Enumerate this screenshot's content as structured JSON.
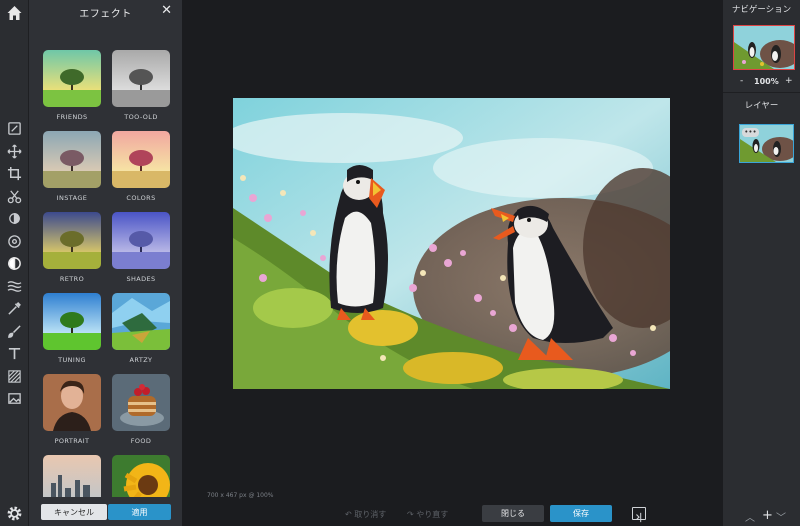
{
  "effects_panel": {
    "title": "エフェクト",
    "close_glyph": "✕",
    "items": [
      {
        "label": "FRIENDS"
      },
      {
        "label": "TOO-OLD"
      },
      {
        "label": "INSTAGE"
      },
      {
        "label": "COLORS"
      },
      {
        "label": "RETRO"
      },
      {
        "label": "SHADES"
      },
      {
        "label": "TUNING"
      },
      {
        "label": "ARTZY"
      },
      {
        "label": "PORTRAIT"
      },
      {
        "label": "FOOD"
      },
      {
        "label": ""
      },
      {
        "label": ""
      }
    ],
    "cancel_label": "キャンセル",
    "apply_label": "適用"
  },
  "toolbar": {
    "icons": [
      "home-icon",
      "image-edit-icon",
      "move-icon",
      "crop-icon",
      "cut-icon",
      "adjust-icon",
      "filter-icon",
      "effect-icon",
      "liquify-icon",
      "draw-icon",
      "brush-icon",
      "text-icon",
      "pattern-icon",
      "image-icon",
      "gear-icon"
    ]
  },
  "workspace": {
    "size_info": "700 x 467 px @ 100%",
    "undo_label": "↶ 取り消す",
    "redo_label": "↷ やり直す",
    "close_label": "閉じる",
    "save_label": "保存"
  },
  "navigation": {
    "title": "ナビゲーション",
    "zoom_minus": "-",
    "zoom_value": "100%",
    "zoom_plus": "+"
  },
  "layers": {
    "title": "レイヤー",
    "more_glyph": "•••"
  },
  "right_bottom": {
    "collapse": "︿",
    "add": "+",
    "expand": "﹀"
  },
  "colors": {
    "accent": "#2a93c9",
    "panel": "#2f3136",
    "workspace": "#1b1c1f"
  }
}
